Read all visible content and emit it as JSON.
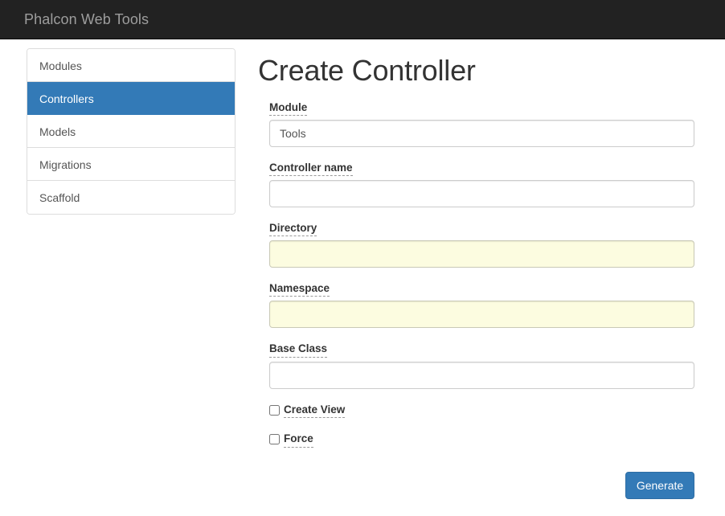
{
  "navbar": {
    "brand": "Phalcon Web Tools",
    "background_color": "#222222",
    "brand_color": "#9d9d9d"
  },
  "sidebar": {
    "items": [
      {
        "label": "Modules",
        "active": false
      },
      {
        "label": "Controllers",
        "active": true
      },
      {
        "label": "Models",
        "active": false
      },
      {
        "label": "Migrations",
        "active": false
      },
      {
        "label": "Scaffold",
        "active": false
      }
    ],
    "active_color": "#337ab7"
  },
  "main": {
    "title": "Create Controller",
    "fields": [
      {
        "label": "Module",
        "value": "Tools",
        "placeholder": "",
        "autofilled": false
      },
      {
        "label": "Controller name",
        "value": "",
        "placeholder": "",
        "autofilled": false
      },
      {
        "label": "Directory",
        "value": "",
        "placeholder": "",
        "autofilled": true
      },
      {
        "label": "Namespace",
        "value": "",
        "placeholder": "",
        "autofilled": true
      },
      {
        "label": "Base Class",
        "value": "",
        "placeholder": "",
        "autofilled": false
      }
    ],
    "checkboxes": [
      {
        "label": "Create View",
        "checked": false
      },
      {
        "label": "Force",
        "checked": false
      }
    ],
    "submit": {
      "label": "Generate",
      "color": "#337ab7"
    },
    "autofill_color": "#fcfce0"
  }
}
